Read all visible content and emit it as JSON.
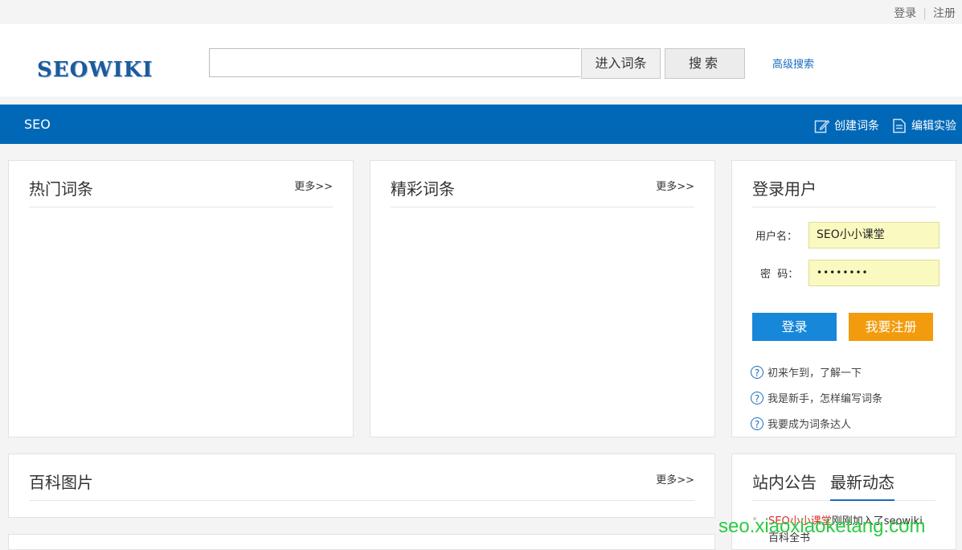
{
  "topbar": {
    "login": "登录",
    "register": "注册"
  },
  "header": {
    "logo": "SEOWIKI",
    "search_value": "",
    "enter_button": "进入词条",
    "search_button": "搜索",
    "advanced_search": "高级搜索"
  },
  "nav": {
    "site": "SEO",
    "create_entry": "创建词条",
    "edit_lab": "编辑实验"
  },
  "hot": {
    "title": "热门词条",
    "more": "更多>>"
  },
  "featured": {
    "title": "精彩词条",
    "more": "更多>>"
  },
  "pictures": {
    "title": "百科图片",
    "more": "更多>>"
  },
  "login_panel": {
    "title": "登录用户",
    "username_label": "用户名：",
    "username_value": "SEO小小课堂",
    "password_label": "密  码：",
    "password_value": "••••••••",
    "login_button": "登录",
    "register_button": "我要注册",
    "help": [
      "初来乍到，了解一下",
      "我是新手，怎样编写词条",
      "我要成为词条达人"
    ]
  },
  "news": {
    "tab_announce": "站内公告",
    "tab_latest": "最新动态",
    "item_user": "SEO小小课堂",
    "item_text": "刚刚加入了seowiki",
    "item_text2": "百科全书"
  },
  "watermark": "seo.xiaoxiaoketang.com",
  "colors": {
    "nav_blue": "#0068b7",
    "login_blue": "#1787d9",
    "register_orange": "#f29b0d",
    "link_blue": "#1a6cbf"
  }
}
